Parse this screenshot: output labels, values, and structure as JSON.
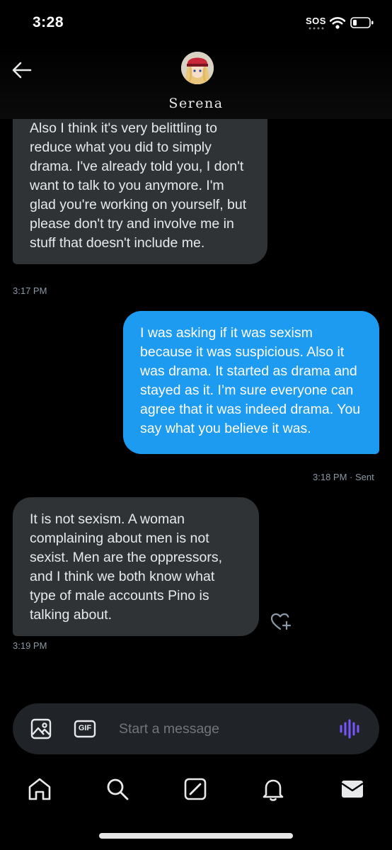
{
  "status_bar": {
    "time": "3:28",
    "sos": "SOS"
  },
  "header": {
    "back_icon": "arrow-left-icon",
    "contact_name": "Serena"
  },
  "messages": [
    {
      "direction": "incoming",
      "text": "Also I think it's very belittling to reduce what you did to simply drama. I've already told you, I don't want to talk to you anymore. I'm glad you're working on yourself, but please don't try and involve me in stuff that doesn't include me.",
      "time": "3:17 PM"
    },
    {
      "direction": "outgoing",
      "text": "I was asking if it was sexism because it was suspicious. Also it was drama. It started as drama and stayed as it. I’m sure everyone can agree that it was indeed drama. You say what you believe it was.",
      "time": "3:18 PM",
      "status": "· Sent"
    },
    {
      "direction": "incoming",
      "text": "It is not sexism. A woman complaining about men is not sexist. Men are the oppressors, and I think we both know what type of male accounts Pino is talking about.",
      "time": "3:19 PM"
    }
  ],
  "composer": {
    "placeholder": "Start a message",
    "image_icon": "image-icon",
    "gif_label": "GIF",
    "voice_icon": "voice-waveform-icon"
  },
  "nav": [
    "home-icon",
    "search-icon",
    "grok-icon",
    "notifications-bell-icon",
    "messages-envelope-icon"
  ],
  "colors": {
    "background": "#000000",
    "incoming_bubble": "#2f3336",
    "outgoing_bubble": "#1d9bf0",
    "composer": "#202327",
    "voice_accent": "#7856ff",
    "meta_text": "#8b98a5"
  }
}
